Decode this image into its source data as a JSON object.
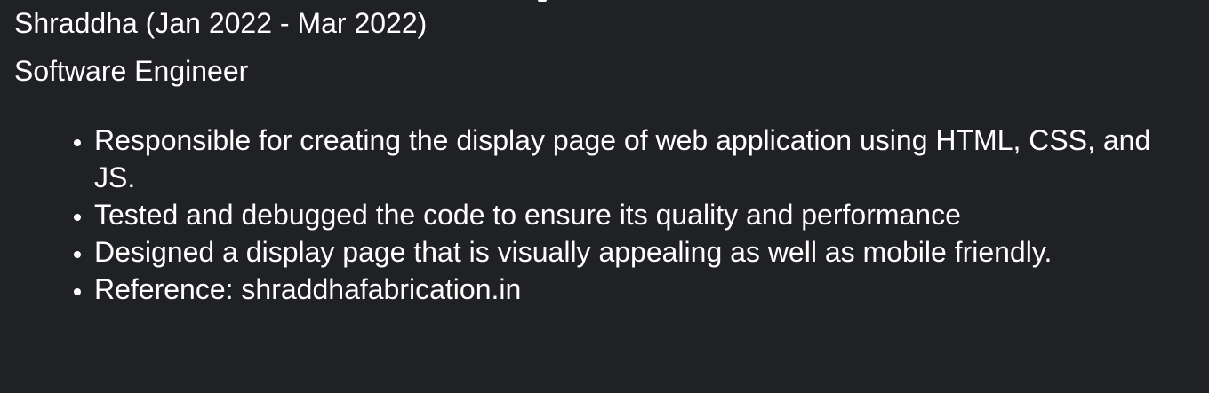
{
  "experience": {
    "company": "Shraddha (Jan 2022 - Mar 2022)",
    "role": "Software Engineer",
    "duties": [
      "Responsible for creating the display page of web application using HTML, CSS, and JS.",
      "Tested and debugged the code to ensure its quality and performance",
      "Designed a display page that is visually appealing as well as mobile friendly.",
      "Reference: shraddhafabrication.in"
    ]
  }
}
